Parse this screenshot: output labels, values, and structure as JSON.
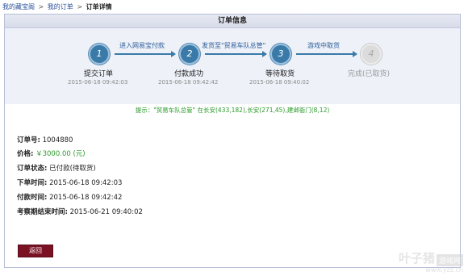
{
  "breadcrumb": {
    "home": "我的藏宝阁",
    "orders": "我的订单",
    "current": "订单详情",
    "sep": ">"
  },
  "panel": {
    "title": "订单信息"
  },
  "steps": [
    {
      "num": "1",
      "label": "提交订单",
      "time": "2015-06-18 09:42:03",
      "done": true
    },
    {
      "num": "2",
      "label": "付款成功",
      "time": "2015-06-18 09:42:42",
      "done": true
    },
    {
      "num": "3",
      "label": "等待取货",
      "time": "2015-06-18 09:40:02",
      "done": true
    },
    {
      "num": "4",
      "label": "完成(已取货)",
      "time": "",
      "done": false
    }
  ],
  "arrows": [
    "进入网易宝付款",
    "发货至\"贸易车队总管\"",
    "游戏中取货"
  ],
  "tip": "提示：\"贸易车队总管\" 在长安(433,182),长安(271,45),建邺衙门(8,12)",
  "order": {
    "id_label": "订单号:",
    "id_value": "1004880",
    "price_label": "价格:",
    "price_value": "￥3000.00 (元)",
    "status_label": "订单状态:",
    "status_value": "已付款(待取货)",
    "order_time_label": "下单时间:",
    "order_time_value": "2015-06-18 09:42:03",
    "pay_time_label": "付款时间:",
    "pay_time_value": "2015-06-18 09:42:42",
    "inspect_end_label": "考察期结束时间:",
    "inspect_end_value": "2015-06-21 09:40:02"
  },
  "back_button": "返回",
  "watermark": {
    "main": "叶子猪",
    "box": "游戏网",
    "url": "www.yzz.cn"
  }
}
